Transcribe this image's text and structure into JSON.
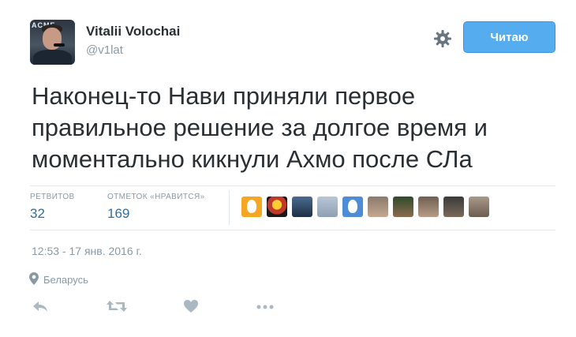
{
  "user": {
    "name": "Vitalii Volochai",
    "handle": "@v1lat",
    "avatar_logo": "ACME"
  },
  "header": {
    "follow_label": "Читаю",
    "settings_icon": "gear-icon"
  },
  "tweet": {
    "text": "Наконец-то Нави приняли первое\nправильное решение за долгое время и\nмоментально кикнули Ахмо после СЛа"
  },
  "stats": {
    "retweets_label": "РЕТВИТОВ",
    "retweets_value": "32",
    "likes_label": "ОТМЕТОК «НРАВИТСЯ»",
    "likes_value": "169"
  },
  "timestamp": "12:53 - 17 янв. 2016 г.",
  "location": "Беларусь",
  "actions": [
    "reply-icon",
    "retweet-icon",
    "like-icon",
    "more-icon"
  ],
  "colors": {
    "accent": "#55acee",
    "stat_value": "#2a6ea8",
    "muted": "#8899a6",
    "text": "#292f33"
  }
}
